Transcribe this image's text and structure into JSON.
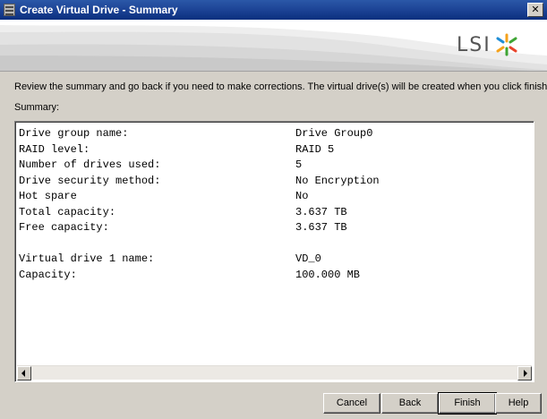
{
  "window": {
    "title": "Create Virtual Drive - Summary",
    "close_glyph": "✕"
  },
  "banner": {
    "logo_text": "LSI",
    "logo_icon": "lsi-star-icon",
    "logo_colors": [
      "#e8442c",
      "#f5a21b",
      "#3fa535",
      "#1f8dd6"
    ]
  },
  "intro_text": "Review the summary and go back if you need to make corrections. The virtual drive(s) will be created when you click finish.",
  "summary_label": "Summary:",
  "summary": [
    {
      "label": "Drive group name:",
      "value": "Drive Group0"
    },
    {
      "label": "RAID level:",
      "value": "RAID 5"
    },
    {
      "label": "Number of drives used:",
      "value": "5"
    },
    {
      "label": "Drive security method:",
      "value": "No Encryption"
    },
    {
      "label": "Hot spare",
      "value": "No"
    },
    {
      "label": "Total capacity:",
      "value": "3.637 TB"
    },
    {
      "label": "Free capacity:",
      "value": "3.637 TB"
    },
    {
      "label": "",
      "value": ""
    },
    {
      "label": "Virtual drive 1 name:",
      "value": "VD_0"
    },
    {
      "label": "Capacity:",
      "value": "100.000 MB"
    }
  ],
  "buttons": {
    "cancel": "Cancel",
    "back": "Back",
    "finish": "Finish",
    "help": "Help"
  }
}
